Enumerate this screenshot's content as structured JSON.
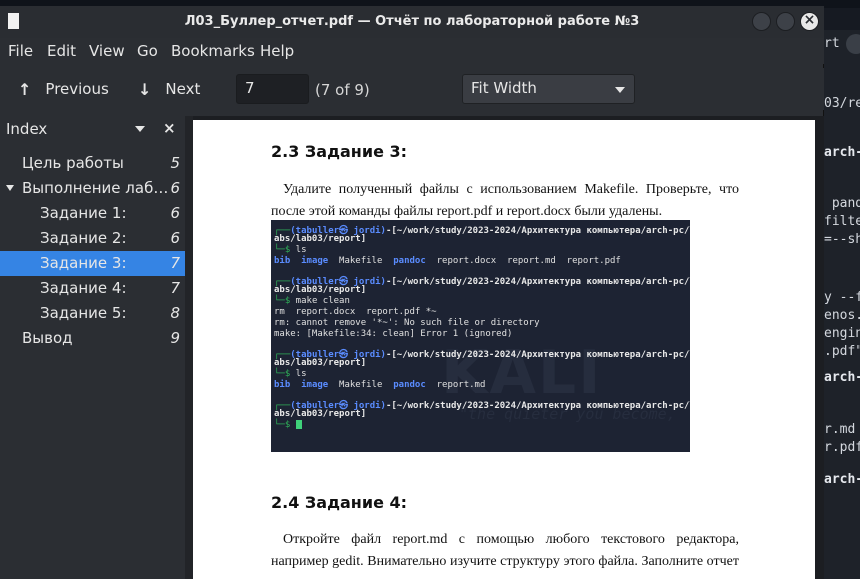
{
  "background": {
    "terminal_lines": [
      {
        "text": "rt",
        "bold": false
      },
      {
        "text": "03/re",
        "bold": false
      },
      {
        "text": "arch-",
        "bold": true
      },
      {
        "text": " pando",
        "bold": false
      },
      {
        "text": "filte",
        "bold": false
      },
      {
        "text": "=--sh",
        "bold": false
      },
      {
        "text": "y --f",
        "bold": false
      },
      {
        "text": "enos.",
        "bold": false
      },
      {
        "text": "engin",
        "bold": false
      },
      {
        "text": ".pdf\"",
        "bold": false
      },
      {
        "text": "arch-",
        "bold": true
      },
      {
        "text": "r.md",
        "bold": false
      },
      {
        "text": "r.pdf",
        "bold": false
      },
      {
        "text": "arch-",
        "bold": true
      }
    ]
  },
  "window": {
    "title": "Л03_Буллер_отчет.pdf — Отчёт по лабораторной работе №3",
    "close_glyph": "×"
  },
  "menu": [
    "File",
    "Edit",
    "View",
    "Go",
    "Bookmarks",
    "Help"
  ],
  "toolbar": {
    "previous_label": "Previous",
    "next_label": "Next",
    "page_value": "7",
    "page_count": "(7 of 9)",
    "zoom_value": "Fit Width"
  },
  "sidebar": {
    "header": "Index",
    "close_glyph": "×",
    "items": [
      {
        "label": "Цель работы",
        "page": "5",
        "level": 0,
        "expander": false,
        "selected": false
      },
      {
        "label": "Выполнение лаб…",
        "page": "6",
        "level": 0,
        "expander": true,
        "selected": false
      },
      {
        "label": "Задание 1:",
        "page": "6",
        "level": 1,
        "expander": false,
        "selected": false
      },
      {
        "label": "Задание 2:",
        "page": "6",
        "level": 1,
        "expander": false,
        "selected": false
      },
      {
        "label": "Задание 3:",
        "page": "7",
        "level": 1,
        "expander": false,
        "selected": true
      },
      {
        "label": "Задание 4:",
        "page": "7",
        "level": 1,
        "expander": false,
        "selected": false
      },
      {
        "label": "Задание 5:",
        "page": "8",
        "level": 1,
        "expander": false,
        "selected": false
      },
      {
        "label": "Вывод",
        "page": "9",
        "level": 0,
        "expander": false,
        "selected": false
      }
    ]
  },
  "document": {
    "section_3_heading": "2.3  Задание 3:",
    "section_3_text": "Удалите полученный файлы с использованием Makefile. Проверьте, что после этой команды файлы report.pdf и report.docx были удалены.",
    "terminal": {
      "prompt_user": "(tabuller㉿ jordi)",
      "prompt_path_1": "-[~/work/study/2023-2024/Архитектура компьютера/arch-pc/l",
      "prompt_path_2": "abs/lab03/report]",
      "prompt_prefix": "┌──",
      "prompt_arrow": "└─$",
      "cmd_ls": " ls",
      "ls1_dirs": [
        "bib",
        "image"
      ],
      "ls1_file_a": "Makefile",
      "ls1_dir_b": "pandoc",
      "ls1_rest": "report.docx  report.md  report.pdf",
      "cmd_make": " make clean",
      "make_out_1": "rm  report.docx  report.pdf *~",
      "make_out_2": "rm: cannot remove '*~': No such file or directory",
      "make_out_3": "make: [Makefile:34: clean] Error 1 (ignored)",
      "ls2_rest": "report.md",
      "watermark": "KALI",
      "watermark_sub": "\"the quieter you become,"
    },
    "section_4_heading": "2.4  Задание 4:",
    "section_4_text": "Откройте файл report.md с помощью любого текстового редактора, например gedit. Внимательно изучите структуру этого файла. Заполните отчет и скомпили-"
  }
}
